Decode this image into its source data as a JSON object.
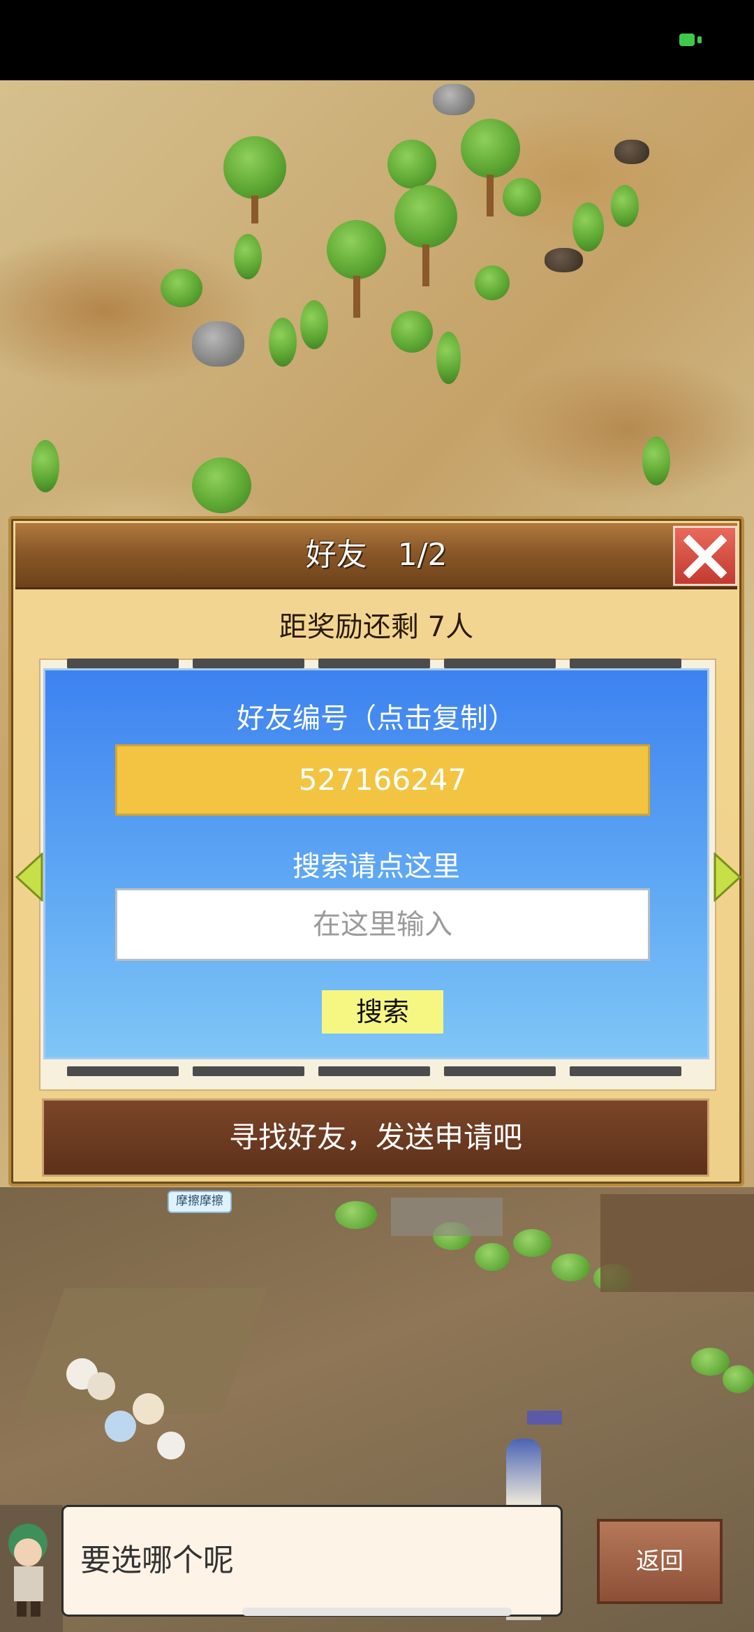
{
  "dialog": {
    "title": "好友　1/2",
    "reward_remaining": "距奖励还剩 7人",
    "friend_id_label": "好友编号（点击复制）",
    "friend_id": "527166247",
    "search_label": "搜索请点这里",
    "search_placeholder": "在这里输入",
    "search_button": "搜索",
    "find_friends": "寻找好友，发送申请吧"
  },
  "world": {
    "tag": "摩擦摩擦"
  },
  "dialogue": {
    "text": "要选哪个呢",
    "back_button": "返回"
  },
  "colors": {
    "accent_blue": "#3d82f0",
    "id_box": "#f3c442",
    "search_button": "#f6f683",
    "header_brown": "#8a5828",
    "close_red": "#c33a30"
  },
  "icons": [
    "battery-icon",
    "close-icon",
    "left-arrow-icon",
    "right-arrow-icon",
    "character-avatar"
  ]
}
